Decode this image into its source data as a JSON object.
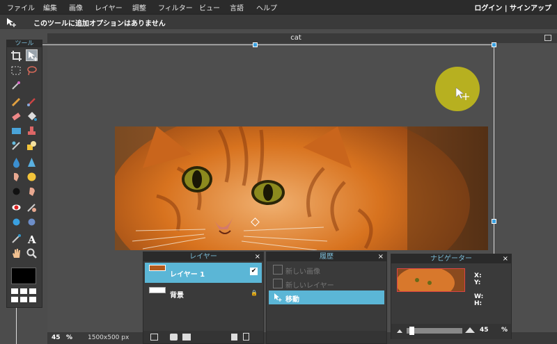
{
  "menu": {
    "items": [
      "ファイル",
      "編集",
      "画像",
      "レイヤー",
      "調整",
      "フィルター",
      "ビュー",
      "言語",
      "ヘルプ"
    ],
    "auth": "ログイン | サインアップ"
  },
  "options_bar": {
    "message": "このツールに追加オプションはありません"
  },
  "toolbox": {
    "title": "ツール"
  },
  "document": {
    "title": "cat"
  },
  "statusbar": {
    "zoom": "45",
    "zoom_unit": "%",
    "dimensions": "1500x500 px"
  },
  "layers_panel": {
    "title": "レイヤー",
    "close": "×",
    "layers": [
      {
        "name": "レイヤー 1",
        "visible_check": "✔"
      },
      {
        "name": "背景",
        "lock": "🔒"
      }
    ]
  },
  "history_panel": {
    "title": "履歴",
    "close": "×",
    "items": [
      "新しい画像",
      "新しいレイヤー",
      "移動"
    ]
  },
  "navigator_panel": {
    "title": "ナビゲーター",
    "close": "×",
    "x_label": "X:",
    "y_label": "Y:",
    "w_label": "W:",
    "h_label": "H:",
    "zoom_value": "45",
    "zoom_unit": "%"
  },
  "colors": {
    "accent": "#5bb6d6",
    "panel_title": "#7bbbd6",
    "cursor_blob": "#b7b020"
  }
}
